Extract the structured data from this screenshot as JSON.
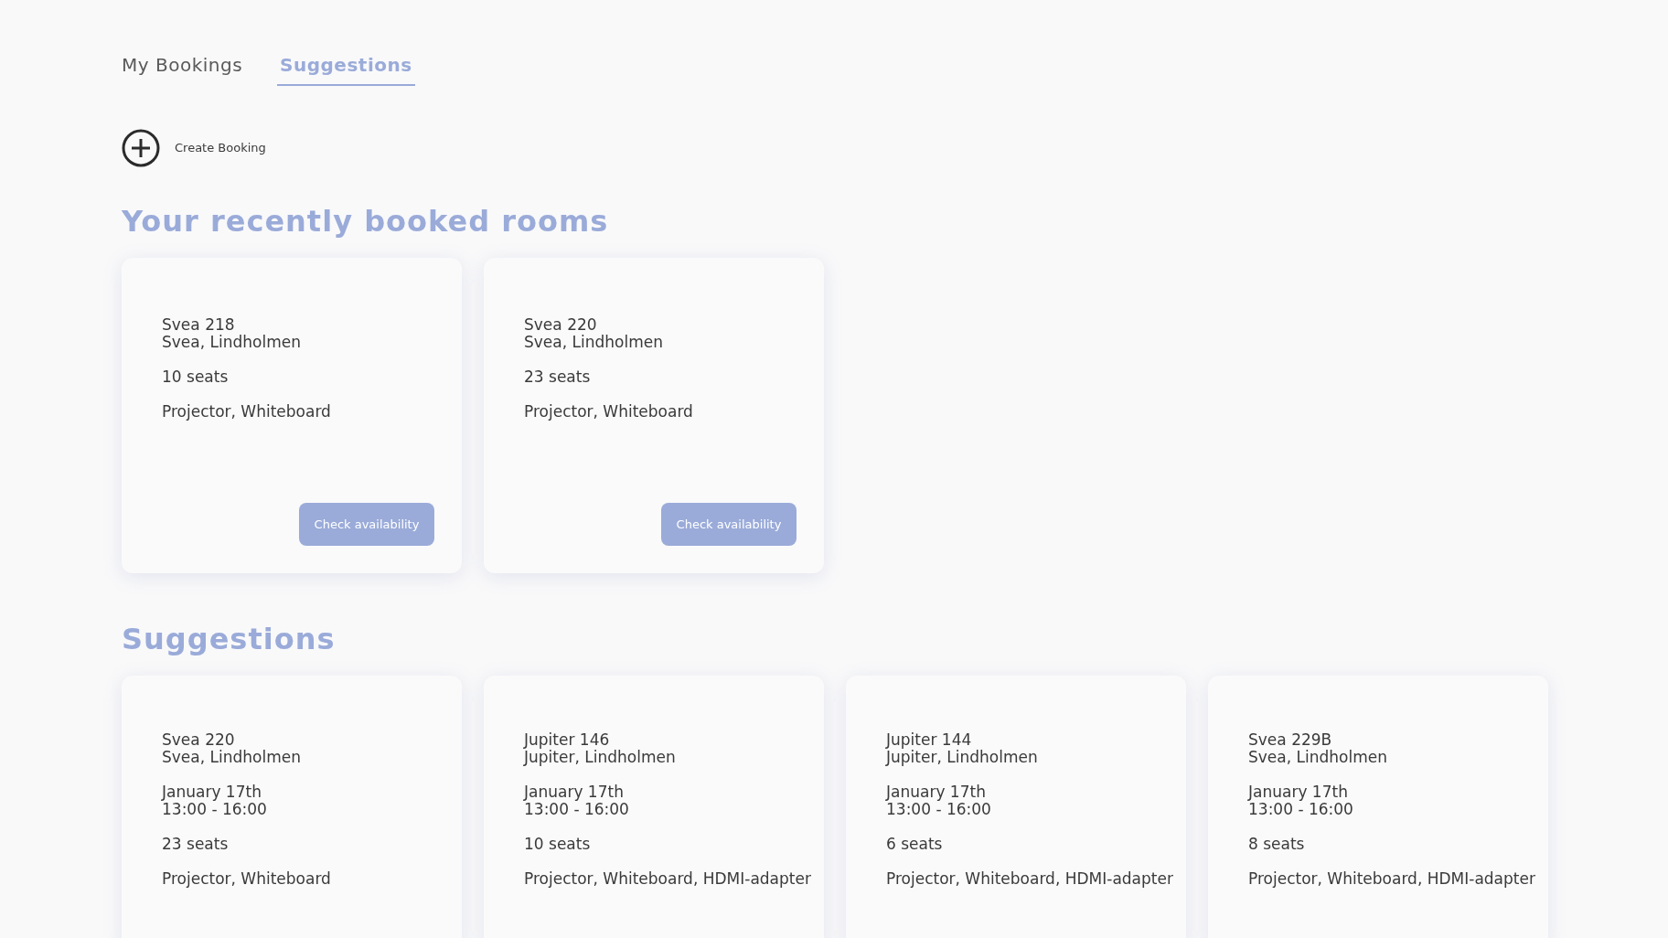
{
  "tabs": [
    {
      "label": "My Bookings",
      "selected": false
    },
    {
      "label": "Suggestions",
      "selected": true
    }
  ],
  "create_booking": {
    "label": "Create Booking"
  },
  "recent": {
    "title": "Your recently booked rooms",
    "rooms": [
      {
        "name": "Svea 218",
        "location": "Svea, Lindholmen",
        "seats": "10 seats",
        "equipment": "Projector, Whiteboard",
        "button": "Check availability"
      },
      {
        "name": "Svea 220",
        "location": "Svea, Lindholmen",
        "seats": "23 seats",
        "equipment": "Projector, Whiteboard",
        "button": "Check availability"
      }
    ]
  },
  "suggestions": {
    "title": "Suggestions",
    "rooms": [
      {
        "name": "Svea 220",
        "location": "Svea, Lindholmen",
        "date": "January 17th",
        "time": "13:00 - 16:00",
        "seats": "23 seats",
        "equipment": "Projector, Whiteboard"
      },
      {
        "name": "Jupiter 146",
        "location": "Jupiter, Lindholmen",
        "date": "January 17th",
        "time": "13:00 - 16:00",
        "seats": "10 seats",
        "equipment": "Projector, Whiteboard, HDMI-adapter"
      },
      {
        "name": "Jupiter 144",
        "location": "Jupiter, Lindholmen",
        "date": "January 17th",
        "time": "13:00 - 16:00",
        "seats": "6 seats",
        "equipment": "Projector, Whiteboard, HDMI-adapter"
      },
      {
        "name": "Svea 229B",
        "location": "Svea, Lindholmen",
        "date": "January 17th",
        "time": "13:00 - 16:00",
        "seats": "8 seats",
        "equipment": "Projector, Whiteboard, HDMI-adapter"
      }
    ]
  }
}
